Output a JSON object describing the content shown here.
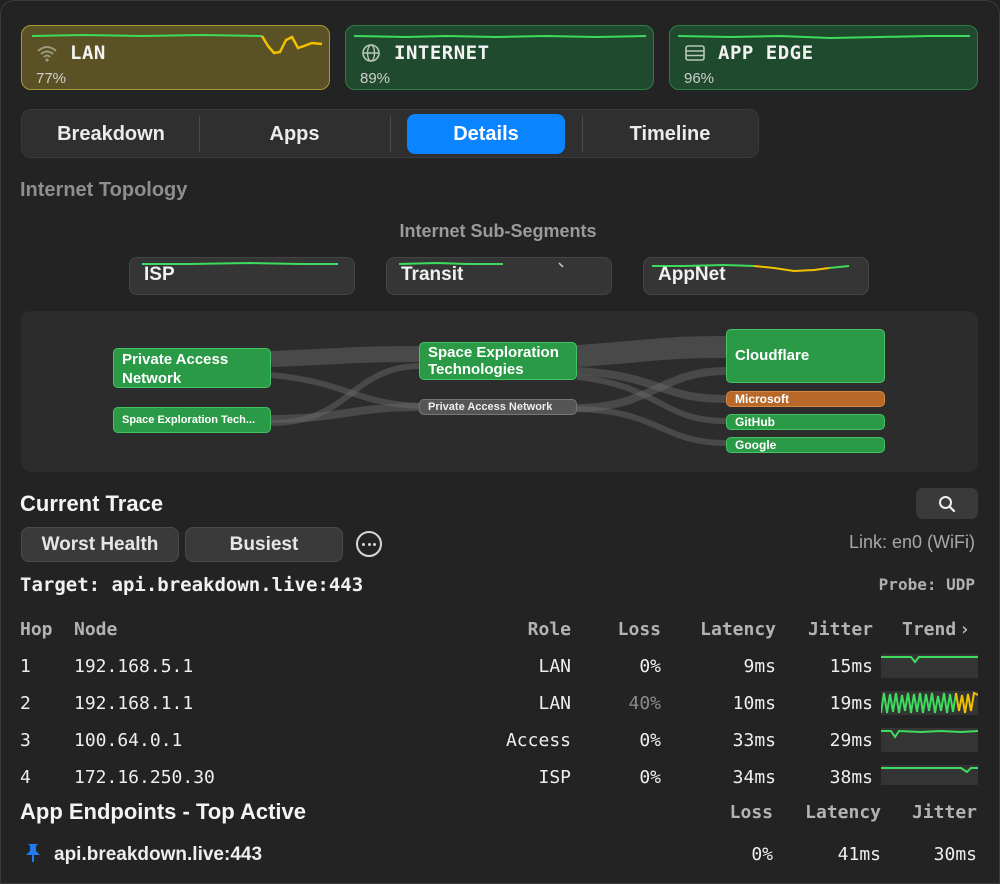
{
  "segments": [
    {
      "name": "LAN",
      "percent": "77%",
      "icon": "wifi-icon",
      "status_color": "#a39a3c"
    },
    {
      "name": "INTERNET",
      "percent": "89%",
      "icon": "globe-icon",
      "status_color": "#2f7d45"
    },
    {
      "name": "APP EDGE",
      "percent": "96%",
      "icon": "server-icon",
      "status_color": "#2f7d45"
    }
  ],
  "tabs": [
    {
      "label": "Breakdown",
      "active": false
    },
    {
      "label": "Apps",
      "active": false
    },
    {
      "label": "Details",
      "active": true
    },
    {
      "label": "Timeline",
      "active": false
    }
  ],
  "topology": {
    "heading": "Internet Topology",
    "sub_heading": "Internet Sub-Segments",
    "sub_segments": [
      "ISP",
      "Transit",
      "AppNet"
    ],
    "sources": [
      "Private Access Network",
      "Space Exploration Tech..."
    ],
    "middle": [
      "Space Exploration Technologies",
      "Private Access Network"
    ],
    "destinations": [
      "Cloudflare",
      "Microsoft",
      "GitHub",
      "Google"
    ],
    "colors": {
      "healthy": "#2a9a46",
      "warning": "#b8692a"
    }
  },
  "trace": {
    "heading": "Current Trace",
    "filters": [
      "Worst Health",
      "Busiest"
    ],
    "link": "Link: en0 (WiFi)",
    "target": "Target: api.breakdown.live:443",
    "probe": "Probe: UDP",
    "columns": {
      "hop": "Hop",
      "node": "Node",
      "role": "Role",
      "loss": "Loss",
      "latency": "Latency",
      "jitter": "Jitter",
      "trend": "Trend"
    },
    "hops": [
      {
        "hop": "1",
        "node": "192.168.5.1",
        "role": "LAN",
        "loss": "0%",
        "latency": "9ms",
        "jitter": "15ms"
      },
      {
        "hop": "2",
        "node": "192.168.1.1",
        "role": "LAN",
        "loss": "40%",
        "latency": "10ms",
        "jitter": "19ms"
      },
      {
        "hop": "3",
        "node": "100.64.0.1",
        "role": "Access",
        "loss": "0%",
        "latency": "33ms",
        "jitter": "29ms"
      },
      {
        "hop": "4",
        "node": "172.16.250.30",
        "role": "ISP",
        "loss": "0%",
        "latency": "34ms",
        "jitter": "38ms"
      }
    ]
  },
  "endpoints": {
    "heading": "App Endpoints - Top Active",
    "columns": {
      "loss": "Loss",
      "latency": "Latency",
      "jitter": "Jitter"
    },
    "rows": [
      {
        "name": "api.breakdown.live:443",
        "loss": "0%",
        "latency": "41ms",
        "jitter": "30ms"
      }
    ]
  }
}
